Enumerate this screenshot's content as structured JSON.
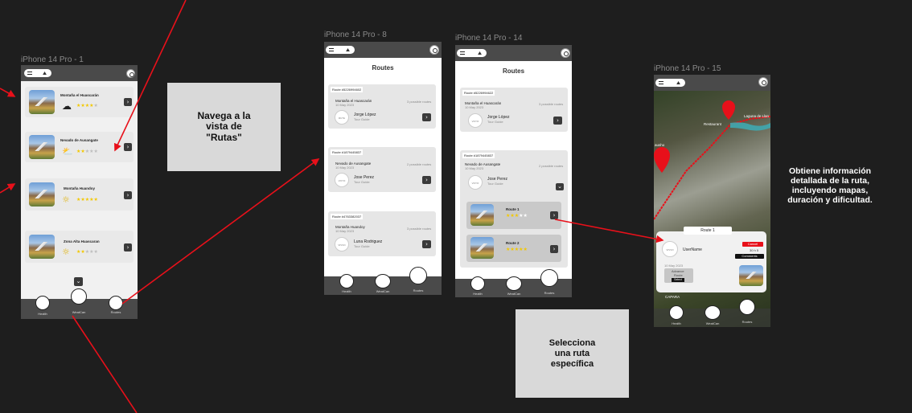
{
  "frames": {
    "f1": "iPhone 14 Pro - 1",
    "f8": "iPhone 14 Pro - 8",
    "f14": "iPhone 14 Pro - 14",
    "f15": "iPhone 14 Pro - 15"
  },
  "colors": {
    "background": "#1e1e1e",
    "arrow": "#e8101a",
    "star": "#f3c800",
    "note": "#d9d9d9"
  },
  "phone1": {
    "routes": [
      {
        "name": "Montaña el Huascarán",
        "weather": "cloud-icon",
        "rating": 4
      },
      {
        "name": "Nevado de Ausangate",
        "weather": "sun-cloud-icon",
        "rating": 2
      },
      {
        "name": "Montaña Huandoy",
        "weather": "sun-icon",
        "rating": 5
      },
      {
        "name": "Zona Alta Huascaran",
        "weather": "sun-icon",
        "rating": 2
      }
    ],
    "nav": [
      "Health",
      "WeatCan",
      "Routes"
    ]
  },
  "phone8": {
    "title": "Routes",
    "cards": [
      {
        "id": "Route #5226994602",
        "name": "Montaña el Huascarán",
        "date": "10 May 2023",
        "count": "3 possible routes",
        "guide": "Jorge López",
        "role": "Tour Guide",
        "avatar": "RUTA"
      },
      {
        "id": "Route #1879445837",
        "name": "Nevado de Ausangate",
        "date": "10 May 2023",
        "count": "2 possible routes",
        "guide": "Jose Perez",
        "role": "Tour Guide",
        "avatar": "VOYO"
      },
      {
        "id": "Route #4763382037",
        "name": "Montaña Huandoy",
        "date": "10 May 2023",
        "count": "3 possible routes",
        "guide": "Luna Rodriguez",
        "role": "Tour Guide",
        "avatar": "VIVVO"
      }
    ],
    "nav": [
      "Health",
      "WeatCan",
      "Routes"
    ]
  },
  "phone14": {
    "title": "Routes",
    "cards": [
      {
        "id": "Route #5226994622",
        "name": "Montaña el Huascarán",
        "date": "10 May 2023",
        "count": "3 possible routes",
        "guide": "Jorge López",
        "role": "Tour Guide",
        "avatar": "VOYO"
      },
      {
        "id": "Route #1879445837",
        "name": "Nevado de Ausangate",
        "date": "10 May 2023",
        "count": "2 possible routes",
        "guide": "Jose Perez",
        "role": "Tour Guide",
        "avatar": "VOYO"
      }
    ],
    "subroutes": [
      {
        "name": "Route 1",
        "rating": 3
      },
      {
        "name": "Route 2",
        "rating": 5
      }
    ],
    "nav": [
      "Health",
      "WeatCan",
      "Routes"
    ]
  },
  "phone15": {
    "places": {
      "restaurant": "Restaurant",
      "lake": "Laguna de Llan",
      "area": "CAPARA",
      "roadsign": "ausho"
    },
    "panel": {
      "title": "Route 1",
      "user": "UserName",
      "avatar": "VIVVO",
      "cancel": "Cancel",
      "duration": "30 h 5",
      "comments": "Comments",
      "date": "10 May 2023",
      "difficulty_label": "Advance",
      "difficulty": "Route",
      "select": "Select"
    },
    "nav": [
      "Health",
      "WeatCan",
      "Routes"
    ]
  },
  "notes": {
    "navigate": "Navega a la\nvista de\n\"Rutas\"",
    "select": "Selecciona\nuna ruta\nespecífica",
    "details": "Obtiene información\ndetallada de la ruta,\nincluyendo mapas,\nduración y dificultad."
  }
}
